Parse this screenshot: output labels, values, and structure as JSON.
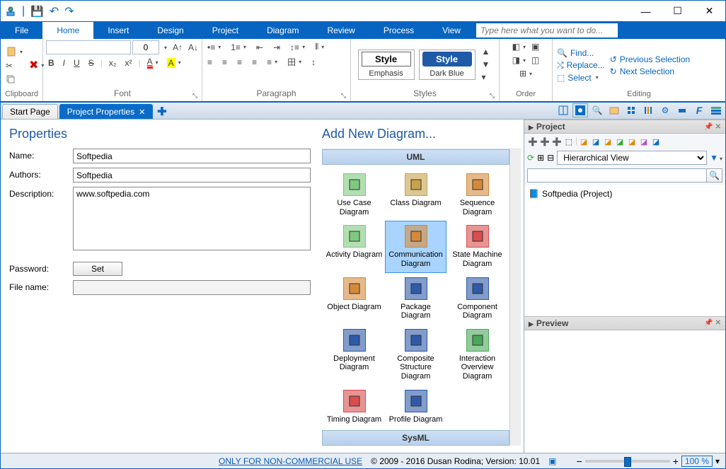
{
  "titlebar": {},
  "menu": {
    "file": "File",
    "home": "Home",
    "insert": "Insert",
    "design": "Design",
    "project": "Project",
    "diagram": "Diagram",
    "review": "Review",
    "process": "Process",
    "view": "View",
    "tellme_placeholder": "Type here what you want to do..."
  },
  "ribbon": {
    "clipboard_label": "Clipboard",
    "font_label": "Font",
    "paragraph_label": "Paragraph",
    "styles_label": "Styles",
    "order_label": "Order",
    "editing_label": "Editing",
    "font_size": "0",
    "bold": "B",
    "italic": "I",
    "underline": "U",
    "strike": "S",
    "style_emphasis": "Style",
    "style_emphasis_caption": "Emphasis",
    "style_dark": "Style",
    "style_dark_caption": "Dark Blue",
    "find": "Find...",
    "replace": "Replace...",
    "select": "Select",
    "prev_sel": "Previous Selection",
    "next_sel": "Next Selection"
  },
  "tabs": {
    "start": "Start Page",
    "props": "Project Properties"
  },
  "properties": {
    "title": "Properties",
    "name_label": "Name:",
    "name_value": "Softpedia",
    "authors_label": "Authors:",
    "authors_value": "Softpedia",
    "desc_label": "Description:",
    "desc_value": "www.softpedia.com",
    "password_label": "Password:",
    "password_btn": "Set",
    "file_label": "File name:",
    "file_value": ""
  },
  "add_diagram": {
    "title": "Add New Diagram...",
    "uml": "UML",
    "sysml": "SysML",
    "items": [
      "Use Case Diagram",
      "Class Diagram",
      "Sequence Diagram",
      "Activity Diagram",
      "Communication Diagram",
      "State Machine Diagram",
      "Object Diagram",
      "Package Diagram",
      "Component Diagram",
      "Deployment Diagram",
      "Composite Structure Diagram",
      "Interaction Overview Diagram",
      "Timing Diagram",
      "Profile Diagram"
    ],
    "icon_colors": [
      "#7fc97f",
      "#c8a24a",
      "#d58a3a",
      "#7fc97f",
      "#d58a3a",
      "#d94d4d",
      "#d58a3a",
      "#2e5aa8",
      "#2e5aa8",
      "#2e5aa8",
      "#2e5aa8",
      "#4aa85a",
      "#d94d4d",
      "#2e5aa8"
    ]
  },
  "project_panel": {
    "title": "Project",
    "view_select": "Hierarchical View",
    "tree_root": "Softpedia (Project)"
  },
  "preview_panel": {
    "title": "Preview"
  },
  "status": {
    "link": "ONLY FOR NON-COMMERCIAL USE",
    "copyright": "© 2009 - 2016 Dusan Rodina; Version: 10.01",
    "zoom": "100 %"
  }
}
